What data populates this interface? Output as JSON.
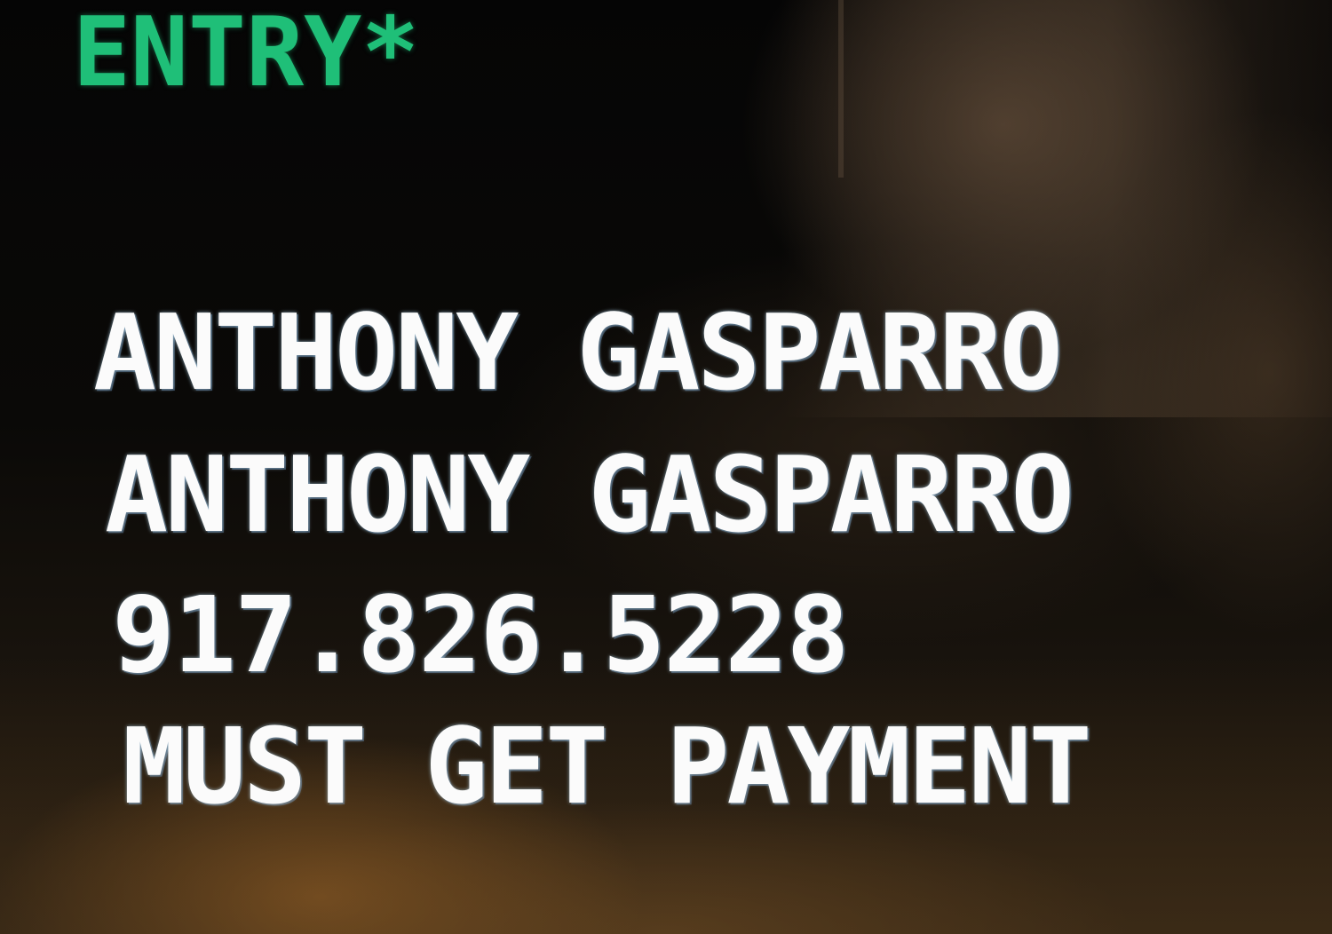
{
  "display": {
    "header": "ENTRY*",
    "lines": [
      "ANTHONY GASPARRO",
      "ANTHONY GASPARRO",
      "917.826.5228",
      "MUST GET PAYMENT"
    ]
  },
  "colors": {
    "header_text": "#1fbf78",
    "body_text": "#fbfbfb",
    "screen_background": "#0d0b08"
  }
}
